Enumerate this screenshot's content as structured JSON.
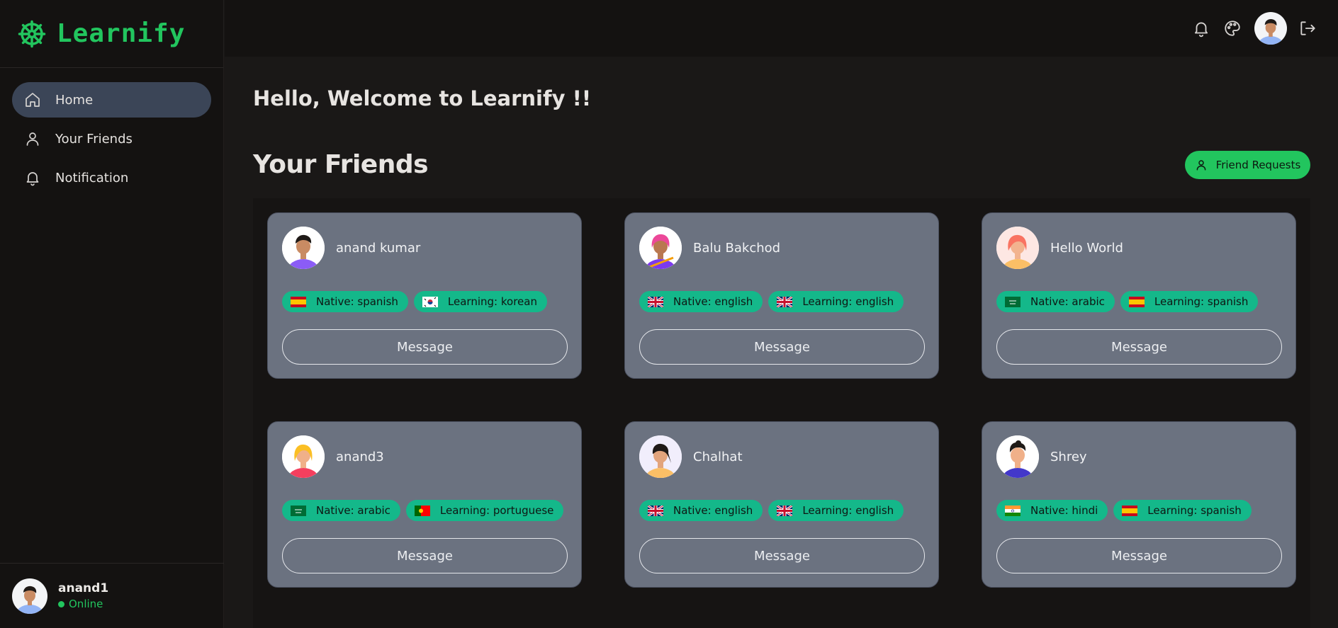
{
  "brand": {
    "name": "Learnify"
  },
  "sidebar": {
    "items": [
      {
        "label": "Home",
        "icon": "home-icon",
        "active": true
      },
      {
        "label": "Your Friends",
        "icon": "user-icon",
        "active": false
      },
      {
        "label": "Notification",
        "icon": "bell-icon",
        "active": false
      }
    ]
  },
  "profile": {
    "name": "anand1",
    "status": "Online"
  },
  "topbar": {
    "icons": [
      "bell-icon",
      "palette-icon",
      "avatar",
      "logout-icon"
    ]
  },
  "main": {
    "welcome": "Hello, Welcome to Learnify !!",
    "section_title": "Your Friends",
    "friend_requests_label": "Friend Requests"
  },
  "friends": [
    {
      "name": "anand kumar",
      "native": "Native: spanish",
      "native_flag": "es",
      "learning": "Learning: korean",
      "learning_flag": "kr",
      "action": "Message"
    },
    {
      "name": "Balu Bakchod",
      "native": "Native: english",
      "native_flag": "gb",
      "learning": "Learning: english",
      "learning_flag": "gb",
      "action": "Message"
    },
    {
      "name": "Hello World",
      "native": "Native: arabic",
      "native_flag": "sa",
      "learning": "Learning: spanish",
      "learning_flag": "es",
      "action": "Message"
    },
    {
      "name": "anand3",
      "native": "Native: arabic",
      "native_flag": "sa",
      "learning": "Learning: portuguese",
      "learning_flag": "pt",
      "action": "Message"
    },
    {
      "name": "Chalhat",
      "native": "Native: english",
      "native_flag": "gb",
      "learning": "Learning: english",
      "learning_flag": "gb",
      "action": "Message"
    },
    {
      "name": "Shrey",
      "native": "Native: hindi",
      "native_flag": "in",
      "learning": "Learning: spanish",
      "learning_flag": "es",
      "action": "Message"
    }
  ],
  "colors": {
    "accent": "#22c55e",
    "badge": "#14b88a",
    "card": "#6b7280",
    "active_nav": "#3b4557"
  }
}
